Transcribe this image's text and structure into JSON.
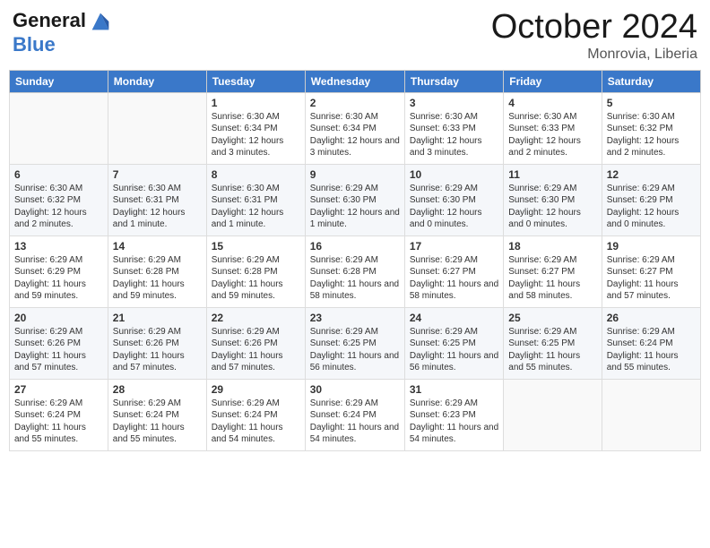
{
  "header": {
    "logo_line1": "General",
    "logo_line2": "Blue",
    "month": "October 2024",
    "location": "Monrovia, Liberia"
  },
  "days_of_week": [
    "Sunday",
    "Monday",
    "Tuesday",
    "Wednesday",
    "Thursday",
    "Friday",
    "Saturday"
  ],
  "weeks": [
    [
      {
        "day": "",
        "info": ""
      },
      {
        "day": "",
        "info": ""
      },
      {
        "day": "1",
        "info": "Sunrise: 6:30 AM\nSunset: 6:34 PM\nDaylight: 12 hours and 3 minutes."
      },
      {
        "day": "2",
        "info": "Sunrise: 6:30 AM\nSunset: 6:34 PM\nDaylight: 12 hours and 3 minutes."
      },
      {
        "day": "3",
        "info": "Sunrise: 6:30 AM\nSunset: 6:33 PM\nDaylight: 12 hours and 3 minutes."
      },
      {
        "day": "4",
        "info": "Sunrise: 6:30 AM\nSunset: 6:33 PM\nDaylight: 12 hours and 2 minutes."
      },
      {
        "day": "5",
        "info": "Sunrise: 6:30 AM\nSunset: 6:32 PM\nDaylight: 12 hours and 2 minutes."
      }
    ],
    [
      {
        "day": "6",
        "info": "Sunrise: 6:30 AM\nSunset: 6:32 PM\nDaylight: 12 hours and 2 minutes."
      },
      {
        "day": "7",
        "info": "Sunrise: 6:30 AM\nSunset: 6:31 PM\nDaylight: 12 hours and 1 minute."
      },
      {
        "day": "8",
        "info": "Sunrise: 6:30 AM\nSunset: 6:31 PM\nDaylight: 12 hours and 1 minute."
      },
      {
        "day": "9",
        "info": "Sunrise: 6:29 AM\nSunset: 6:30 PM\nDaylight: 12 hours and 1 minute."
      },
      {
        "day": "10",
        "info": "Sunrise: 6:29 AM\nSunset: 6:30 PM\nDaylight: 12 hours and 0 minutes."
      },
      {
        "day": "11",
        "info": "Sunrise: 6:29 AM\nSunset: 6:30 PM\nDaylight: 12 hours and 0 minutes."
      },
      {
        "day": "12",
        "info": "Sunrise: 6:29 AM\nSunset: 6:29 PM\nDaylight: 12 hours and 0 minutes."
      }
    ],
    [
      {
        "day": "13",
        "info": "Sunrise: 6:29 AM\nSunset: 6:29 PM\nDaylight: 11 hours and 59 minutes."
      },
      {
        "day": "14",
        "info": "Sunrise: 6:29 AM\nSunset: 6:28 PM\nDaylight: 11 hours and 59 minutes."
      },
      {
        "day": "15",
        "info": "Sunrise: 6:29 AM\nSunset: 6:28 PM\nDaylight: 11 hours and 59 minutes."
      },
      {
        "day": "16",
        "info": "Sunrise: 6:29 AM\nSunset: 6:28 PM\nDaylight: 11 hours and 58 minutes."
      },
      {
        "day": "17",
        "info": "Sunrise: 6:29 AM\nSunset: 6:27 PM\nDaylight: 11 hours and 58 minutes."
      },
      {
        "day": "18",
        "info": "Sunrise: 6:29 AM\nSunset: 6:27 PM\nDaylight: 11 hours and 58 minutes."
      },
      {
        "day": "19",
        "info": "Sunrise: 6:29 AM\nSunset: 6:27 PM\nDaylight: 11 hours and 57 minutes."
      }
    ],
    [
      {
        "day": "20",
        "info": "Sunrise: 6:29 AM\nSunset: 6:26 PM\nDaylight: 11 hours and 57 minutes."
      },
      {
        "day": "21",
        "info": "Sunrise: 6:29 AM\nSunset: 6:26 PM\nDaylight: 11 hours and 57 minutes."
      },
      {
        "day": "22",
        "info": "Sunrise: 6:29 AM\nSunset: 6:26 PM\nDaylight: 11 hours and 57 minutes."
      },
      {
        "day": "23",
        "info": "Sunrise: 6:29 AM\nSunset: 6:25 PM\nDaylight: 11 hours and 56 minutes."
      },
      {
        "day": "24",
        "info": "Sunrise: 6:29 AM\nSunset: 6:25 PM\nDaylight: 11 hours and 56 minutes."
      },
      {
        "day": "25",
        "info": "Sunrise: 6:29 AM\nSunset: 6:25 PM\nDaylight: 11 hours and 55 minutes."
      },
      {
        "day": "26",
        "info": "Sunrise: 6:29 AM\nSunset: 6:24 PM\nDaylight: 11 hours and 55 minutes."
      }
    ],
    [
      {
        "day": "27",
        "info": "Sunrise: 6:29 AM\nSunset: 6:24 PM\nDaylight: 11 hours and 55 minutes."
      },
      {
        "day": "28",
        "info": "Sunrise: 6:29 AM\nSunset: 6:24 PM\nDaylight: 11 hours and 55 minutes."
      },
      {
        "day": "29",
        "info": "Sunrise: 6:29 AM\nSunset: 6:24 PM\nDaylight: 11 hours and 54 minutes."
      },
      {
        "day": "30",
        "info": "Sunrise: 6:29 AM\nSunset: 6:24 PM\nDaylight: 11 hours and 54 minutes."
      },
      {
        "day": "31",
        "info": "Sunrise: 6:29 AM\nSunset: 6:23 PM\nDaylight: 11 hours and 54 minutes."
      },
      {
        "day": "",
        "info": ""
      },
      {
        "day": "",
        "info": ""
      }
    ]
  ]
}
